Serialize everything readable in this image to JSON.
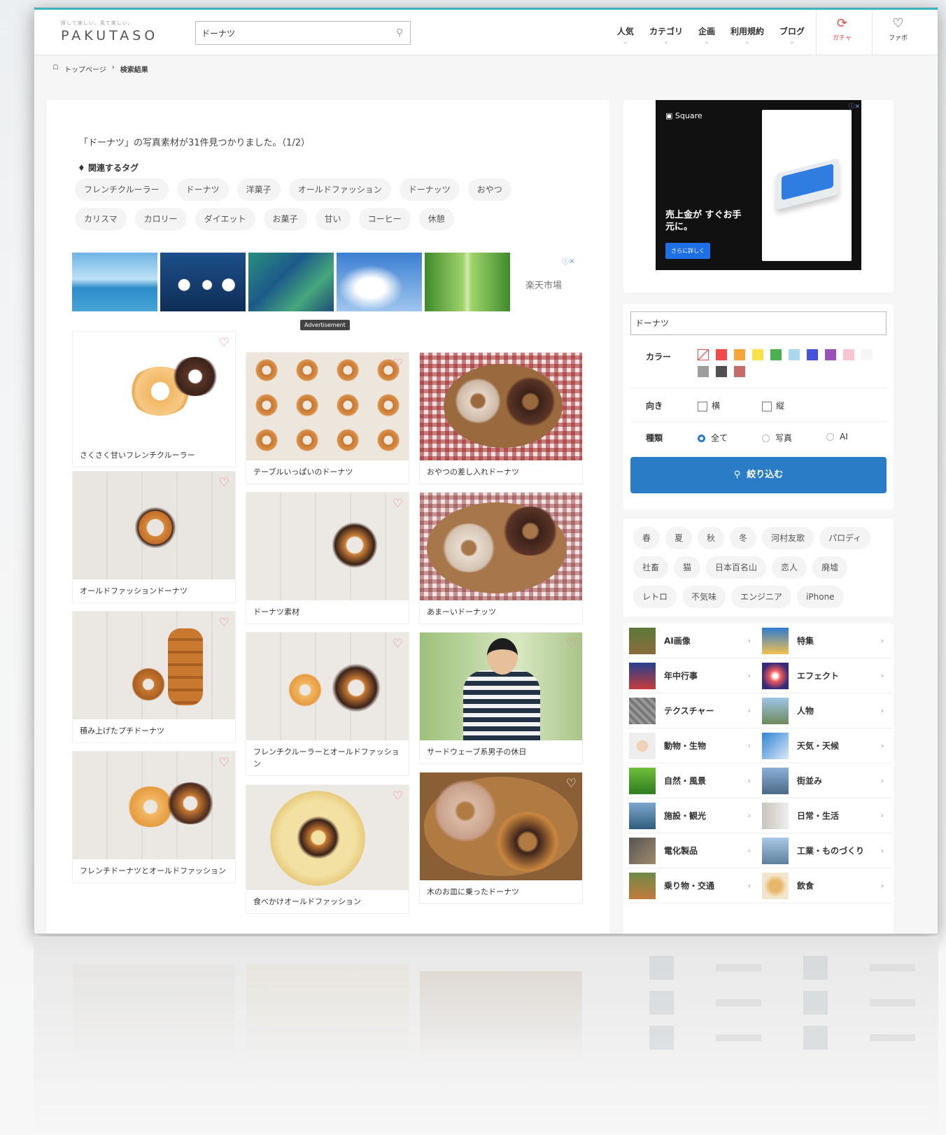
{
  "header": {
    "logo_tagline": "探して楽しい、見て楽しい。",
    "logo_text": "PAKUTASO",
    "search_value": "ドーナツ",
    "nav": [
      "人気",
      "カテゴリ",
      "企画",
      "利用規約",
      "ブログ"
    ],
    "gacha_label": "ガチャ",
    "fav_label": "ファボ"
  },
  "breadcrumb": {
    "home": "トップページ",
    "current": "検索結果"
  },
  "results": {
    "summary": "「ドーナツ」の写真素材が31件見つかりました。（1/2）",
    "tags_title": "関連するタグ",
    "tags": [
      "フレンチクルーラー",
      "ドーナツ",
      "洋菓子",
      "オールドファッション",
      "ドーナッツ",
      "おやつ",
      "カリスマ",
      "カロリー",
      "ダイエット",
      "お菓子",
      "甘い",
      "コーヒー",
      "休憩"
    ]
  },
  "banner": {
    "store": "楽天市場",
    "ad_mark": "ⓘ✕",
    "advertisement": "Advertisement"
  },
  "photos": [
    {
      "caption": "さくさく甘いフレンチクルーラー"
    },
    {
      "caption": "テーブルいっぱいのドーナツ"
    },
    {
      "caption": "おやつの差し入れドーナツ"
    },
    {
      "caption": "オールドファッションドーナツ"
    },
    {
      "caption": "ドーナツ素材"
    },
    {
      "caption": "あまーいドーナッツ"
    },
    {
      "caption": "積み上げたプチドーナツ"
    },
    {
      "caption": "フレンチクルーラーとオールドファッション"
    },
    {
      "caption": "サードウェーブ系男子の休日"
    },
    {
      "caption": "フレンチドーナツとオールドファッション"
    },
    {
      "caption": "食べかけオールドファッション"
    },
    {
      "caption": "木のお皿に乗ったドーナツ"
    }
  ],
  "side_ad": {
    "brand": "Square",
    "headline": "売上金が すぐお手元に。",
    "cta": "さらに詳しく"
  },
  "filter": {
    "keyword": "ドーナツ",
    "color_label": "カラー",
    "colors": [
      "#ffffff",
      "#ef4b4b",
      "#f7a73a",
      "#f9e14b",
      "#4caf50",
      "#a7d8f0",
      "#4254d8",
      "#9a52b8",
      "#f8c6d2",
      "#f6f6f6",
      "#9e9e9e",
      "#505050",
      "#c76a6a"
    ],
    "orientation_label": "向き",
    "orientation_options": [
      "横",
      "縦"
    ],
    "type_label": "種類",
    "type_options": [
      "全て",
      "写真",
      "AI"
    ],
    "button_label": "絞り込む"
  },
  "side_tags": [
    "春",
    "夏",
    "秋",
    "冬",
    "河村友歌",
    "パロディ",
    "社畜",
    "猫",
    "日本百名山",
    "恋人",
    "廃墟",
    "レトロ",
    "不気味",
    "エンジニア",
    "iPhone"
  ],
  "categories": [
    "AI画像",
    "特集",
    "年中行事",
    "エフェクト",
    "テクスチャー",
    "人物",
    "動物・生物",
    "天気・天候",
    "自然・風景",
    "街並み",
    "施設・観光",
    "日常・生活",
    "電化製品",
    "工業・ものづくり",
    "乗り物・交通",
    "飲食"
  ]
}
